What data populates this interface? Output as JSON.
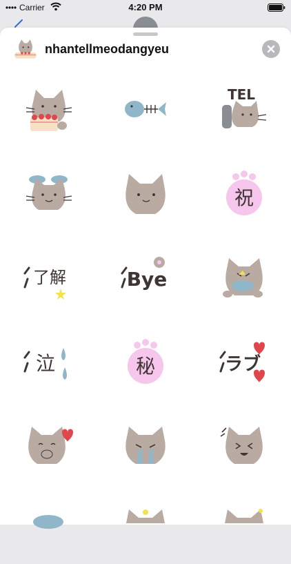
{
  "status_bar": {
    "carrier": "Carrier",
    "time": "4:20 PM",
    "signal_icon": "signal-dots-icon",
    "wifi_icon": "wifi-icon",
    "battery_icon": "battery-icon"
  },
  "header": {
    "app_name": "nhantellmeodangyeu",
    "close_icon": "close-x-icon"
  },
  "stickers": [
    {
      "name": "cat-with-cake"
    },
    {
      "name": "fish-bone"
    },
    {
      "name": "cat-tel"
    },
    {
      "name": "cat-with-fish-hat"
    },
    {
      "name": "cat-face"
    },
    {
      "name": "celebrate-paw",
      "text": "祝"
    },
    {
      "name": "ryokai-star",
      "text": "了解"
    },
    {
      "name": "bye-paw",
      "text": "Bye"
    },
    {
      "name": "cat-eating-fish"
    },
    {
      "name": "cry-text",
      "text": "泣"
    },
    {
      "name": "secret-paw",
      "text": "秘"
    },
    {
      "name": "love-text",
      "text": "ラブ"
    },
    {
      "name": "cat-heart-shy"
    },
    {
      "name": "cat-crying"
    },
    {
      "name": "cat-laughing"
    }
  ],
  "colors": {
    "cat_gray": "#b9aaa2",
    "fish_blue": "#8fb7c9",
    "paw_pink": "#f6c6ec",
    "heart_red": "#e0474c",
    "star_yellow": "#f4e24a",
    "ink": "#3f3633"
  }
}
